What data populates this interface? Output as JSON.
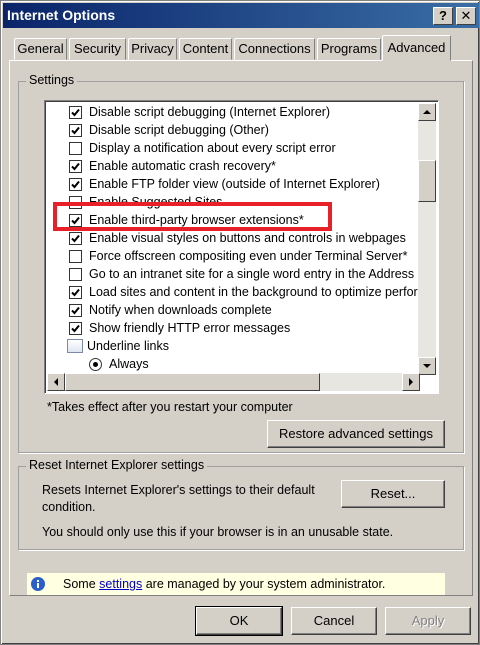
{
  "window": {
    "title": "Internet Options",
    "help_label": "?",
    "close_label": "✕"
  },
  "tabs": [
    {
      "label": "General"
    },
    {
      "label": "Security"
    },
    {
      "label": "Privacy"
    },
    {
      "label": "Content"
    },
    {
      "label": "Connections"
    },
    {
      "label": "Programs"
    },
    {
      "label": "Advanced",
      "active": true
    }
  ],
  "settings": {
    "group_title": "Settings",
    "items": [
      {
        "label": "Disable script debugging (Internet Explorer)",
        "type": "checkbox",
        "checked": true
      },
      {
        "label": "Disable script debugging (Other)",
        "type": "checkbox",
        "checked": true
      },
      {
        "label": "Display a notification about every script error",
        "type": "checkbox",
        "checked": false
      },
      {
        "label": "Enable automatic crash recovery*",
        "type": "checkbox",
        "checked": true
      },
      {
        "label": "Enable FTP folder view (outside of Internet Explorer)",
        "type": "checkbox",
        "checked": true
      },
      {
        "label": "Enable Suggested Sites",
        "type": "checkbox",
        "checked": false
      },
      {
        "label": "Enable third-party browser extensions*",
        "type": "checkbox",
        "checked": true,
        "highlighted": true
      },
      {
        "label": "Enable visual styles on buttons and controls in webpages",
        "type": "checkbox",
        "checked": true
      },
      {
        "label": "Force offscreen compositing even under Terminal Server*",
        "type": "checkbox",
        "checked": false
      },
      {
        "label": "Go to an intranet site for a single word entry in the Address bar",
        "type": "checkbox",
        "checked": false
      },
      {
        "label": "Load sites and content in the background to optimize performance",
        "type": "checkbox",
        "checked": true
      },
      {
        "label": "Notify when downloads complete",
        "type": "checkbox",
        "checked": true
      },
      {
        "label": "Show friendly HTTP error messages",
        "type": "checkbox",
        "checked": true
      },
      {
        "label": "Underline links",
        "type": "category"
      },
      {
        "label": "Always",
        "type": "radio",
        "checked": true
      }
    ],
    "restart_note": "*Takes effect after you restart your computer",
    "restore_button": "Restore advanced settings"
  },
  "reset": {
    "group_title": "Reset Internet Explorer settings",
    "description": "Resets Internet Explorer's settings to their default condition.",
    "warning": "You should only use this if your browser is in an unusable state.",
    "reset_button": "Reset..."
  },
  "infobar": {
    "text_before": "Some ",
    "link": "settings",
    "text_after": " are managed by your system administrator."
  },
  "buttons": {
    "ok": "OK",
    "cancel": "Cancel",
    "apply": "Apply"
  },
  "colors": {
    "highlight_box": "#e8202a",
    "title_bar": "#0a246a",
    "info_background": "#ffffe1"
  }
}
